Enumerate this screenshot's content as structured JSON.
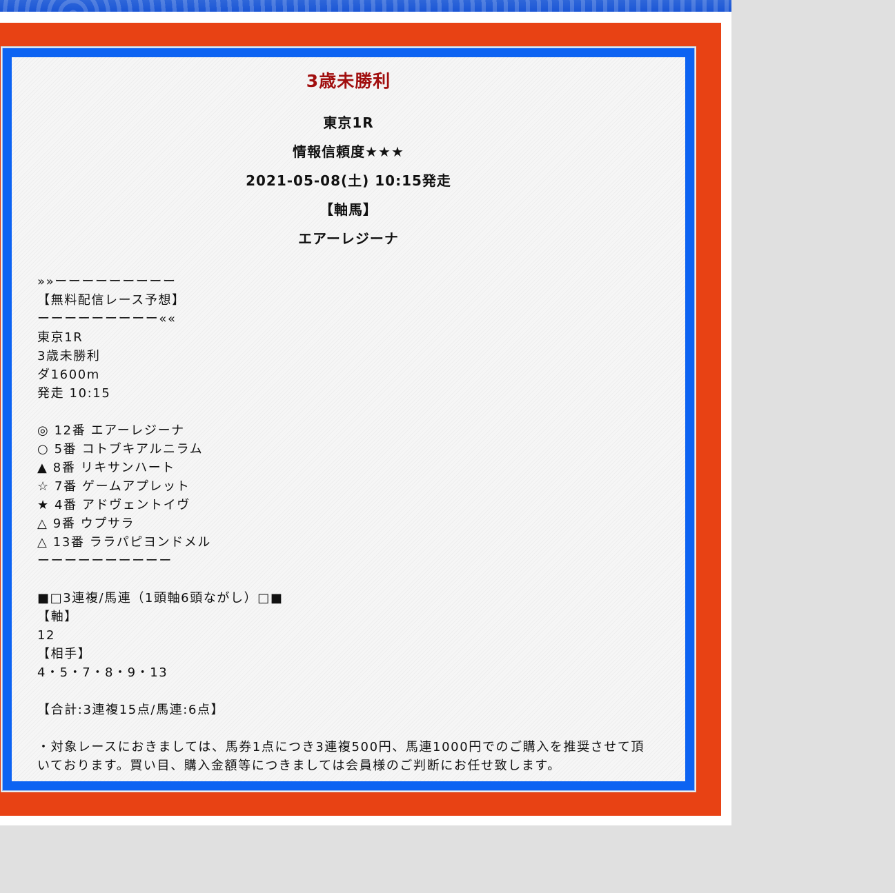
{
  "race": {
    "title": "3歳未勝利",
    "venue": "東京1R",
    "reliability": "情報信頼度★★★",
    "start": "2021-05-08(土) 10:15発走",
    "axis_label": "【軸馬】",
    "axis_horse": "エアーレジーナ"
  },
  "post": {
    "lines": [
      "»»ーーーーーーーーー",
      "【無料配信レース予想】",
      "ーーーーーーーーー««",
      "東京1R",
      "3歳未勝利",
      "ダ1600m",
      "発走 10:15",
      "",
      "◎ 12番 エアーレジーナ",
      "○ 5番 コトブキアルニラム",
      "▲ 8番 リキサンハート",
      "☆ 7番 ゲームアプレット",
      "★ 4番 アドヴェントイヴ",
      "△ 9番 ウプサラ",
      "△ 13番 ララパピヨンドメル",
      "ーーーーーーーーーー",
      "",
      "■□3連複/馬連（1頭軸6頭ながし）□■",
      "【軸】",
      "12",
      "【相手】",
      "4・5・7・8・9・13",
      "",
      "【合計:3連複15点/馬連:6点】",
      ""
    ],
    "note": "・対象レースにおきましては、馬券1点につき3連複500円、馬連1000円でのご購入を推奨させて頂いております。買い目、購入金額等につきましては会員様のご判断にお任せ致します。"
  }
}
